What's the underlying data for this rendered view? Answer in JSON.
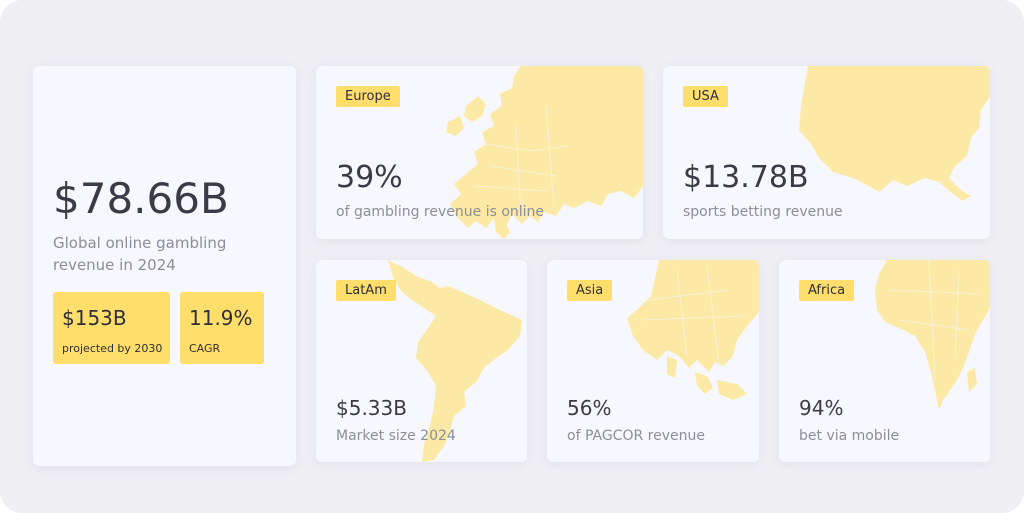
{
  "colors": {
    "accent": "#ffde6b",
    "map": "#fde9a6",
    "card": "#f7f8fd",
    "background": "#efeff4"
  },
  "global": {
    "value": "$78.66B",
    "caption": "Global online gambling revenue in 2024",
    "chips": [
      {
        "value": "$153B",
        "caption": "projected by 2030"
      },
      {
        "value": "11.9%",
        "caption": "CAGR"
      }
    ]
  },
  "regions": {
    "europe": {
      "tag": "Europe",
      "value": "39%",
      "caption": "of gambling revenue is online"
    },
    "usa": {
      "tag": "USA",
      "value": "$13.78B",
      "caption": "sports betting revenue"
    },
    "latam": {
      "tag": "LatAm",
      "value": "$5.33B",
      "caption": "Market size 2024"
    },
    "asia": {
      "tag": "Asia",
      "value": "56%",
      "caption": "of PAGCOR revenue"
    },
    "africa": {
      "tag": "Africa",
      "value": "94%",
      "caption": "bet via mobile"
    }
  }
}
